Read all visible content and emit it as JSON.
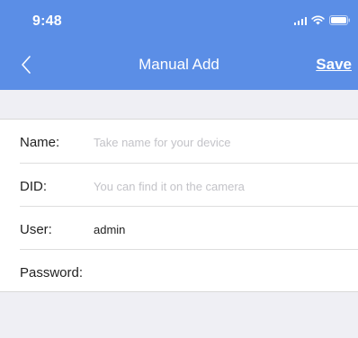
{
  "status_bar": {
    "time": "9:48",
    "icons": [
      "signal-icon",
      "wifi-icon",
      "battery-icon"
    ]
  },
  "nav": {
    "back_icon": "chevron-left-icon",
    "title": "Manual Add",
    "save_label": "Save"
  },
  "form": {
    "fields": [
      {
        "label": "Name:",
        "value": "",
        "placeholder": "Take name for your device"
      },
      {
        "label": "DID:",
        "value": "",
        "placeholder": "You can find it on the camera"
      },
      {
        "label": "User:",
        "value": "admin",
        "placeholder": ""
      },
      {
        "label": "Password:",
        "value": "",
        "placeholder": ""
      }
    ]
  },
  "colors": {
    "header": "#5b8ee6",
    "background": "#efeff4",
    "placeholder": "#c3c3c8"
  }
}
